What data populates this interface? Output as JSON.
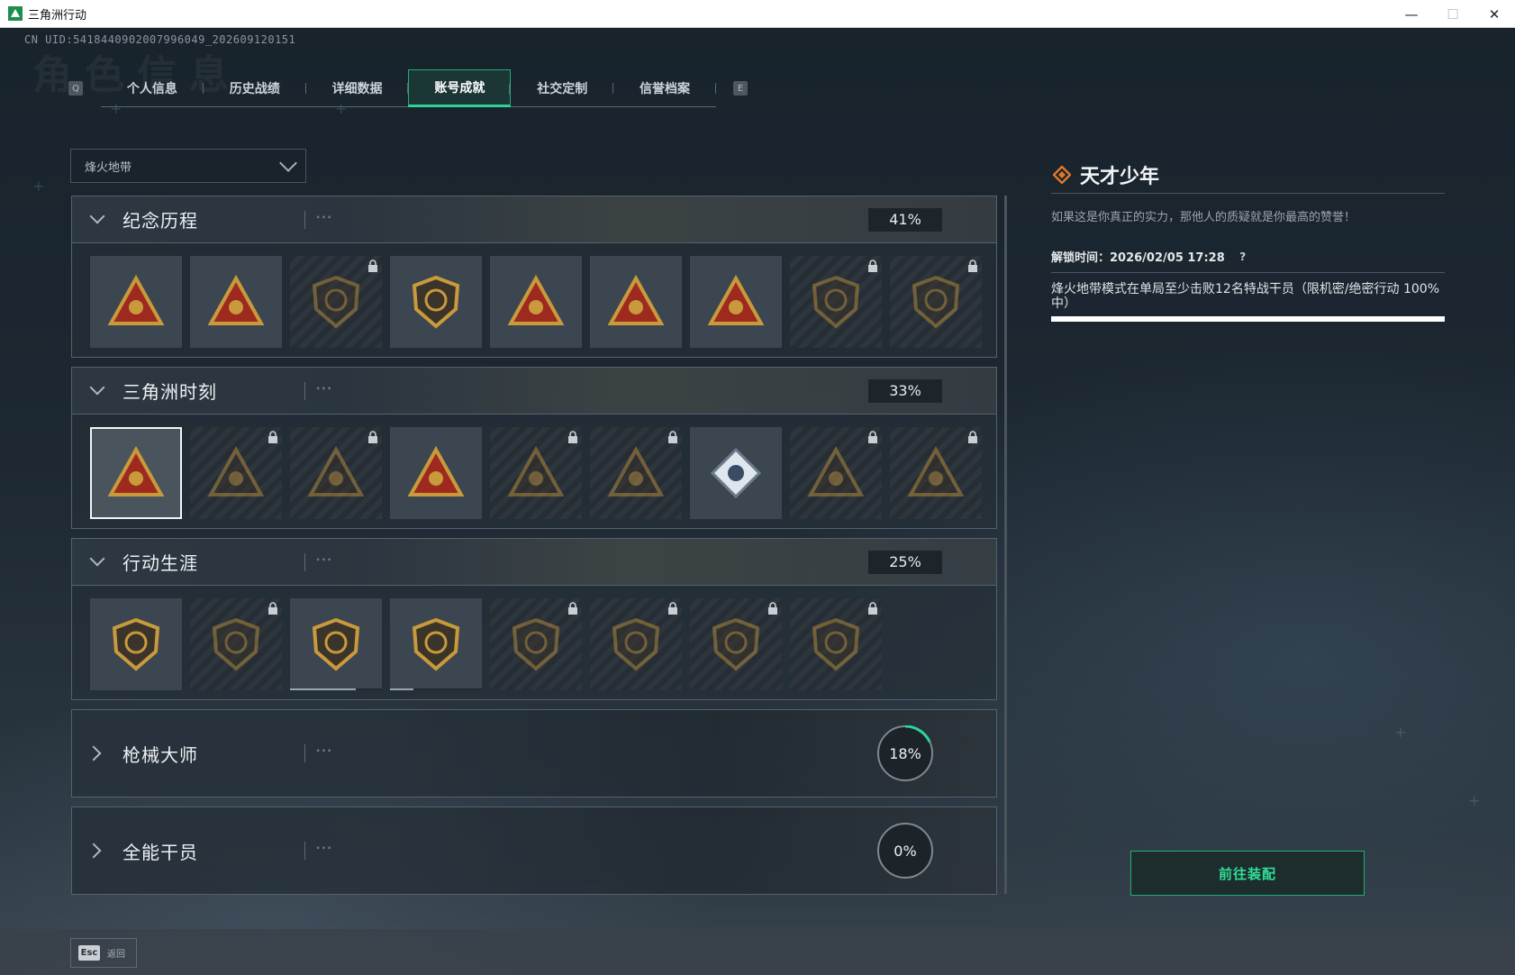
{
  "window": {
    "title": "三角洲行动",
    "minimize": "—",
    "maximize": "☐",
    "close": "✕"
  },
  "uid_text": "CN UID:5418440902007996049_202609120151",
  "bg_heading": "角色信息",
  "tabs": {
    "prev_key": "Q",
    "next_key": "E",
    "items": [
      {
        "label": "个人信息"
      },
      {
        "label": "历史战绩"
      },
      {
        "label": "详细数据"
      },
      {
        "label": "账号成就",
        "active": true
      },
      {
        "label": "社交定制"
      },
      {
        "label": "信誉档案"
      }
    ]
  },
  "mode_dropdown": {
    "selected": "烽火地带"
  },
  "sections": [
    {
      "title": "纪念历程",
      "percent": "41%",
      "expanded": true,
      "badges": [
        {
          "icon": "triangle-delta-badge-icon",
          "locked": false
        },
        {
          "icon": "helicopter-badge-icon",
          "locked": false
        },
        {
          "icon": "shield-emblem-badge-icon",
          "locked": true
        },
        {
          "icon": "gold-medal-badge-icon",
          "locked": false
        },
        {
          "icon": "bird-triangle-badge-icon",
          "locked": false
        },
        {
          "icon": "number-one-badge-icon",
          "locked": false
        },
        {
          "icon": "number-two-badge-icon",
          "locked": false
        },
        {
          "icon": "round-crest-badge-icon",
          "locked": true
        },
        {
          "icon": "octagon-crest-badge-icon",
          "locked": true
        }
      ]
    },
    {
      "title": "三角洲时刻",
      "percent": "33%",
      "expanded": true,
      "badges": [
        {
          "icon": "operator-triangle-badge-icon",
          "locked": false,
          "selected": true
        },
        {
          "icon": "soldier-kneel-badge-icon",
          "locked": true
        },
        {
          "icon": "star-triangle-badge-icon",
          "locked": true
        },
        {
          "icon": "squad-triangle-badge-icon",
          "locked": false
        },
        {
          "icon": "fighters-badge-icon",
          "locked": true
        },
        {
          "icon": "fish-triangle-badge-icon",
          "locked": true
        },
        {
          "icon": "rose-diamond-badge-icon",
          "locked": false
        },
        {
          "icon": "skull-wing-badge-icon",
          "locked": true
        },
        {
          "icon": "skull-triangle-badge-icon",
          "locked": true
        }
      ]
    },
    {
      "title": "行动生涯",
      "percent": "25%",
      "expanded": true,
      "badges": [
        {
          "icon": "star-medal-badge-icon",
          "locked": false
        },
        {
          "icon": "hexshield-badge-icon",
          "locked": true
        },
        {
          "icon": "police-badge-icon",
          "locked": false,
          "progress": 0.72
        },
        {
          "icon": "gem-shield-badge-icon",
          "locked": false,
          "progress": 0.25
        },
        {
          "icon": "round-ring-badge-icon",
          "locked": true
        },
        {
          "icon": "skull-crosshair-badge-icon",
          "locked": true
        },
        {
          "icon": "eye-ring-badge-icon",
          "locked": true
        },
        {
          "icon": "eagle-shield-badge-icon",
          "locked": true
        }
      ]
    },
    {
      "title": "枪械大师",
      "percent": "18%",
      "progress": 0.18,
      "expanded": false
    },
    {
      "title": "全能干员",
      "percent": "0%",
      "progress": 0,
      "expanded": false
    }
  ],
  "detail": {
    "name": "天才少年",
    "description": "如果这是你真正的实力，那他人的质疑就是你最高的赞誉！",
    "unlock_time": "解锁时间：2026/02/05 17:28",
    "requirement": "烽火地带模式在单局至少击败12名特战干员（限机密/绝密行动 100%中）",
    "progress": 1.0
  },
  "equip_button": {
    "label": "前往装配"
  },
  "back_hint": {
    "key": "Esc",
    "label": "返回"
  },
  "colors": {
    "accent": "#2ed39a",
    "badge_gold": "#c89a3c",
    "badge_red": "#9e2a1f",
    "diamond_orange": "#e0782a"
  }
}
